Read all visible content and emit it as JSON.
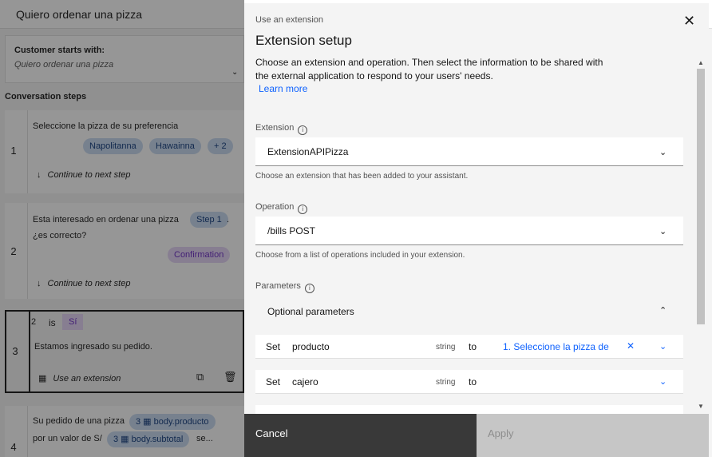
{
  "background": {
    "title": "Quiero ordenar una pizza",
    "customer_starts_label": "Customer starts with:",
    "customer_starts_value": "Quiero ordenar una pizza",
    "conversation_steps_label": "Conversation steps",
    "steps": [
      {
        "number": "1",
        "text": "Seleccione la pizza de su preferencia",
        "tags": [
          "Napolitanna",
          "Hawainna",
          "+ 2"
        ],
        "continue": "Continue to next step"
      },
      {
        "number": "2",
        "text_line1": "Esta interesado en ordenar una pizza",
        "tag_step": "Step 1",
        "text_suffix": ".",
        "text_line2": "¿es correcto?",
        "tag_confirmation": "Confirmation",
        "continue": "Continue to next step"
      },
      {
        "number": "3",
        "condition_num": "2",
        "condition_op": "is",
        "condition_val": "Sí",
        "text": "Estamos ingresado su pedido.",
        "action": "Use an extension"
      },
      {
        "number": "4",
        "text_line1": "Su pedido de una pizza",
        "var1_num": "3",
        "var1": "body.producto",
        "text_line2": "por un valor de S/",
        "var2_num": "3",
        "var2": "body.subtotal",
        "text_tail": "se..."
      }
    ]
  },
  "modal": {
    "label": "Use an extension",
    "title": "Extension setup",
    "description": "Choose an extension and operation. Then select the information to be shared with the external application to respond to your users' needs.",
    "learn_more": "Learn more",
    "extension_label": "Extension",
    "extension_value": "ExtensionAPIPizza",
    "extension_helper": "Choose an extension that has been added to your assistant.",
    "operation_label": "Operation",
    "operation_value": "/bills POST",
    "operation_helper": "Choose from a list of operations included in your extension.",
    "parameters_label": "Parameters",
    "optional_parameters": "Optional parameters",
    "params": [
      {
        "set": "Set",
        "name": "producto",
        "type": "string",
        "to": "to",
        "value": "1. Seleccione la pizza de"
      },
      {
        "set": "Set",
        "name": "cajero",
        "type": "string",
        "to": "to",
        "value": ""
      }
    ],
    "cancel": "Cancel",
    "apply": "Apply"
  },
  "colors": {
    "accent": "#0f62fe",
    "tag_blue_bg": "#c7d9f0",
    "tag_purple_bg": "#e4d3f6",
    "cancel_bg": "#393939",
    "apply_bg": "#c6c6c6"
  }
}
